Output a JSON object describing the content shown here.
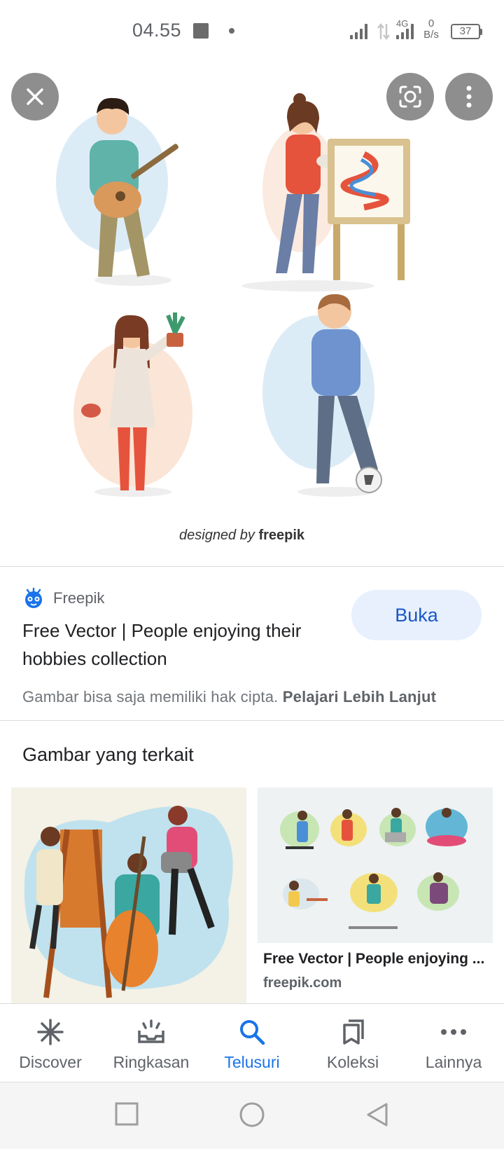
{
  "status_bar": {
    "time": "04.55",
    "network": "4G",
    "speed_value": "0",
    "speed_unit": "B/s",
    "battery": "37"
  },
  "hero": {
    "credit_prefix": "designed by",
    "credit_brand": "freepik"
  },
  "result": {
    "source_name": "Freepik",
    "title": "Free Vector | People enjoying their hobbies collection",
    "open_label": "Buka",
    "copyright_text": "Gambar bisa saja memiliki hak cipta.",
    "learn_more": "Pelajari Lebih Lanjut"
  },
  "related": {
    "heading": "Gambar yang terkait",
    "items": [
      {
        "title": "",
        "domain": ""
      },
      {
        "title": "Free Vector | People enjoying ...",
        "domain": "freepik.com"
      }
    ]
  },
  "bottom_nav": {
    "items": [
      {
        "label": "Discover",
        "icon": "asterisk-icon"
      },
      {
        "label": "Ringkasan",
        "icon": "updates-icon"
      },
      {
        "label": "Telusuri",
        "icon": "search-icon"
      },
      {
        "label": "Koleksi",
        "icon": "bookmarks-icon"
      },
      {
        "label": "Lainnya",
        "icon": "more-horizontal-icon"
      }
    ],
    "active_index": 2
  },
  "colors": {
    "accent": "#1a73e8",
    "button_bg": "#e8f0fe",
    "muted": "#5f6368"
  }
}
